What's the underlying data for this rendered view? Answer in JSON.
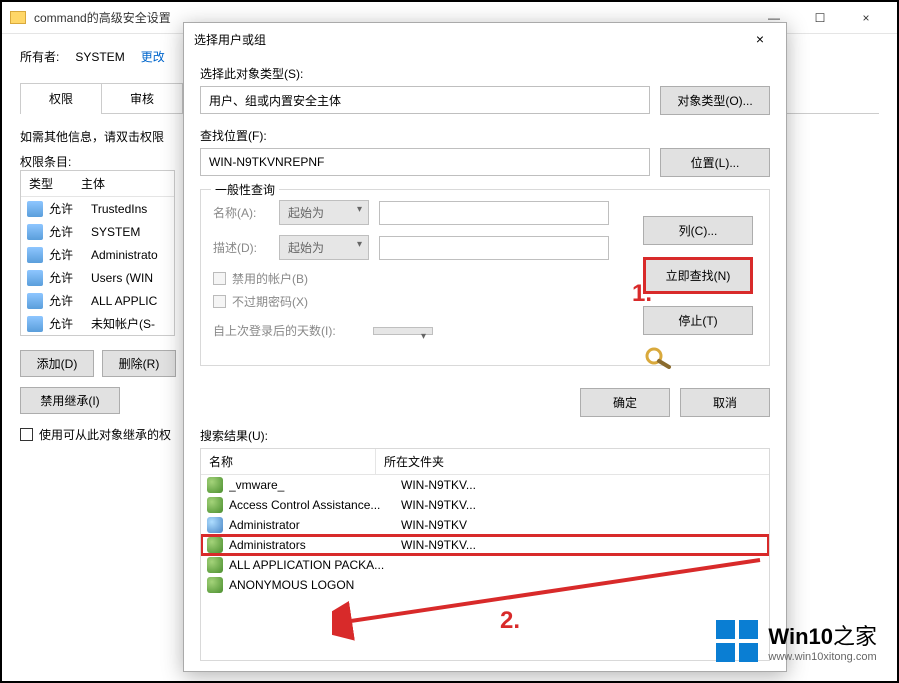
{
  "bg": {
    "title": "command的高级安全设置",
    "owner_label": "所有者:",
    "owner_value": "SYSTEM",
    "change_link": "更改",
    "tabs": [
      "权限",
      "审核"
    ],
    "info": "如需其他信息，请双击权限",
    "entries_label": "权限条目:",
    "cols": {
      "type": "类型",
      "principal": "主体"
    },
    "rows": [
      {
        "type": "允许",
        "principal": "TrustedIns"
      },
      {
        "type": "允许",
        "principal": "SYSTEM"
      },
      {
        "type": "允许",
        "principal": "Administrato"
      },
      {
        "type": "允许",
        "principal": "Users (WIN"
      },
      {
        "type": "允许",
        "principal": "ALL APPLIC"
      },
      {
        "type": "允许",
        "principal": "未知帐户(S-"
      }
    ],
    "add_btn": "添加(D)",
    "remove_btn": "删除(R)",
    "disable_inherit": "禁用继承(I)",
    "replace_chk": "使用可从此对象继承的权"
  },
  "dlg": {
    "title": "选择用户或组",
    "obj_type_label": "选择此对象类型(S):",
    "obj_type_value": "用户、组或内置安全主体",
    "obj_type_btn": "对象类型(O)...",
    "location_label": "查找位置(F):",
    "location_value": "WIN-N9TKVNREPNF",
    "location_btn": "位置(L)...",
    "common_group": "一般性查询",
    "name_label": "名称(A):",
    "desc_label": "描述(D):",
    "startswith": "起始为",
    "disabled_chk": "禁用的帐户(B)",
    "noexpire_chk": "不过期密码(X)",
    "days_label": "自上次登录后的天数(I):",
    "columns_btn": "列(C)...",
    "findnow_btn": "立即查找(N)",
    "stop_btn": "停止(T)",
    "ok_btn": "确定",
    "cancel_btn": "取消",
    "results_label": "搜索结果(U):",
    "res_cols": {
      "name": "名称",
      "folder": "所在文件夹"
    },
    "results": [
      {
        "ico": "grp",
        "name": "_vmware_",
        "folder": "WIN-N9TKV..."
      },
      {
        "ico": "grp",
        "name": "Access Control Assistance...",
        "folder": "WIN-N9TKV..."
      },
      {
        "ico": "usr",
        "name": "Administrator",
        "folder": "WIN-N9TKV"
      },
      {
        "ico": "grp",
        "name": "Administrators",
        "folder": "WIN-N9TKV...",
        "hl": true
      },
      {
        "ico": "grp",
        "name": "ALL APPLICATION PACKA...",
        "folder": ""
      },
      {
        "ico": "grp",
        "name": "ANONYMOUS LOGON",
        "folder": ""
      }
    ]
  },
  "annotations": {
    "one": "1.",
    "two": "2."
  },
  "watermark": {
    "brand": "Win10",
    "suffix": "之家",
    "url": "www.win10xitong.com"
  }
}
